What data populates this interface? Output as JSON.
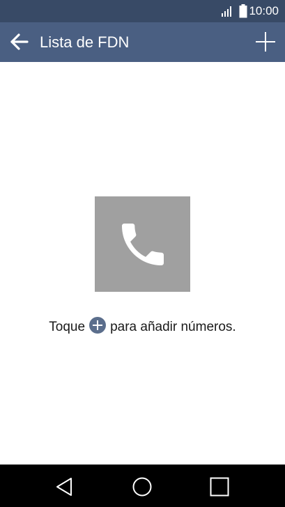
{
  "status_bar": {
    "time": "10:00",
    "signal_icon": "signal-bars-icon",
    "battery_icon": "battery-full-icon"
  },
  "app_bar": {
    "title": "Lista de FDN",
    "back_icon": "arrow-left-icon",
    "add_icon": "plus-icon"
  },
  "empty_state": {
    "illustration_icon": "phone-handset-icon",
    "hint_before": "Toque",
    "hint_icon": "plus-circle-icon",
    "hint_after": "para añadir números."
  },
  "nav_bar": {
    "back_icon": "triangle-back-icon",
    "home_icon": "circle-home-icon",
    "recents_icon": "square-recents-icon"
  },
  "colors": {
    "status_bar_bg": "#384a66",
    "app_bar_bg": "#4a5f82",
    "illustration_bg": "#a0a0a0",
    "hint_plus_bg": "#5b6e8c",
    "nav_bar_bg": "#000000"
  }
}
